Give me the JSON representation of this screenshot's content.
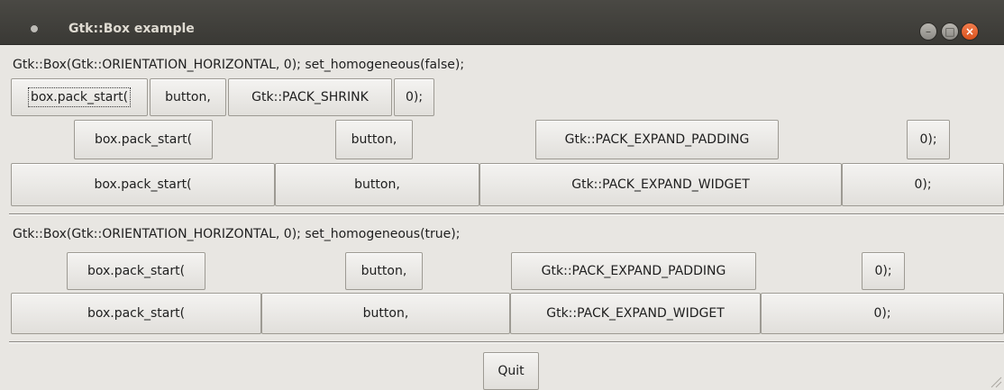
{
  "window": {
    "title": "Gtk::Box example",
    "minimize_symbol": "–",
    "maximize_symbol": "□",
    "close_symbol": "×"
  },
  "section1": {
    "label": "Gtk::Box(Gtk::ORIENTATION_HORIZONTAL, 0); set_homogeneous(false);",
    "rows": [
      [
        "box.pack_start(",
        "button,",
        "Gtk::PACK_SHRINK",
        "0);"
      ],
      [
        "box.pack_start(",
        "button,",
        "Gtk::PACK_EXPAND_PADDING",
        "0);"
      ],
      [
        "box.pack_start(",
        "button,",
        "Gtk::PACK_EXPAND_WIDGET",
        "0);"
      ]
    ]
  },
  "section2": {
    "label": "Gtk::Box(Gtk::ORIENTATION_HORIZONTAL, 0); set_homogeneous(true);",
    "rows": [
      [
        "box.pack_start(",
        "button,",
        "Gtk::PACK_EXPAND_PADDING",
        "0);"
      ],
      [
        "box.pack_start(",
        "button,",
        "Gtk::PACK_EXPAND_WIDGET",
        "0);"
      ]
    ]
  },
  "footer": {
    "quit_label": "Quit"
  }
}
